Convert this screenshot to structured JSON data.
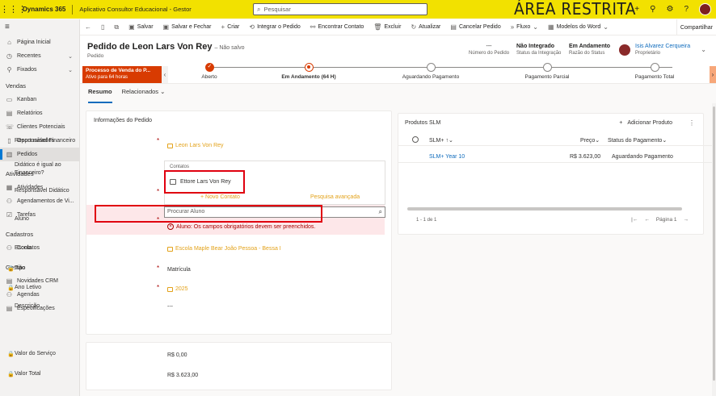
{
  "topbar": {
    "brand": "Dynamics 365",
    "app_name": "Aplicativo Consultor Educacional - Gestor",
    "search_placeholder": "Pesquisar",
    "banner": "ÁREA RESTRITA"
  },
  "commands": {
    "save": "Salvar",
    "save_close": "Salvar e Fechar",
    "create": "Criar",
    "integrate": "Integrar o Pedido",
    "find_contact": "Encontrar Contato",
    "delete": "Excluir",
    "refresh": "Atualizar",
    "cancel_order": "Cancelar Pedido",
    "flow": "Fluxo",
    "word_templates": "Modelos do Word",
    "share": "Compartilhar"
  },
  "sidebar": {
    "home": "Página Inicial",
    "recent": "Recentes",
    "pinned": "Fixados",
    "groups": [
      {
        "title": "Vendas",
        "items": [
          "Kanban",
          "Relatórios",
          "Clientes Potenciais",
          "Oportunidades",
          "Pedidos"
        ]
      },
      {
        "title": "Atividades",
        "items": [
          "Atividades",
          "Agendamentos de Vi...",
          "Tarefas"
        ]
      },
      {
        "title": "Cadastros",
        "items": [
          "Contatos"
        ]
      },
      {
        "title": "Gestão",
        "items": [
          "Novidades CRM",
          "Agendas",
          "Especificações"
        ]
      }
    ]
  },
  "header": {
    "title": "Pedido de Leon Lars Von Rey",
    "not_saved": "– Não salvo",
    "entity": "Pedido",
    "order_number_value": "---",
    "order_number_label": "Número do Pedido",
    "integration_value": "Não Integrado",
    "integration_label": "Status da Integração",
    "status_value": "Em Andamento",
    "status_label": "Razão do Status",
    "owner_value": "Isis Alvarez Cerqueira",
    "owner_label": "Proprietário"
  },
  "bpf": {
    "process_name": "Processo de Venda do P...",
    "active_for": "Ativo para 64 horas",
    "stages": [
      {
        "label": "Aberto",
        "state": "done"
      },
      {
        "label": "Em Andamento  (64 H)",
        "state": "current"
      },
      {
        "label": "Aguardando Pagamento",
        "state": "todo"
      },
      {
        "label": "Pagamento Parcial",
        "state": "todo"
      },
      {
        "label": "Pagamento Total",
        "state": "todo"
      }
    ]
  },
  "tabs": {
    "summary": "Resumo",
    "related": "Relacionados"
  },
  "form": {
    "section_title": "Informações do Pedido",
    "financial_label": "Responsável Financeiro",
    "financial_value": "Leon Lars Von Rey",
    "didactic_equal_label": "Didático é igual ao Financeiro?",
    "didactic_label": "Responsável Didático",
    "student_label": "Aluno",
    "student_placeholder": "Procurar Aluno",
    "student_error": "Aluno: Os campos obrigatórios devem ser preenchidos.",
    "school_label": "Escola",
    "school_value": "Escola Maple Bear João Pessoa - Bessa I",
    "type_label": "Tipo",
    "type_value": "Matrícula",
    "year_label": "Ano Letivo",
    "year_value": "2025",
    "description_label": "Descrição",
    "description_value": "---"
  },
  "lookup_dropdown": {
    "header": "Contatos",
    "result": "Ettore Lars Von Rey",
    "new_contact": "Novo Contato",
    "advanced": "Pesquisa avançada"
  },
  "totals": {
    "service_label": "Valor do Serviço",
    "service_value": "R$ 0,00",
    "total_label": "Valor Total",
    "total_value": "R$ 3.623,00"
  },
  "subgrid": {
    "title": "Produtos SLM",
    "add": "Adicionar Produto",
    "columns": [
      "SLM+",
      "Preço",
      "Status do Pagamento"
    ],
    "rows": [
      {
        "product": "SLM+ Year 10",
        "price": "R$ 3.623,00",
        "status": "Aguardando Pagamento"
      }
    ],
    "count": "1 - 1 de 1",
    "page": "Página 1"
  },
  "colors": {
    "topbar": "#f2e100",
    "accent": "#d83b01",
    "link": "#0f6cbd",
    "lookup": "#e3a21a",
    "error": "#a80000",
    "highlight": "#e0000f"
  }
}
